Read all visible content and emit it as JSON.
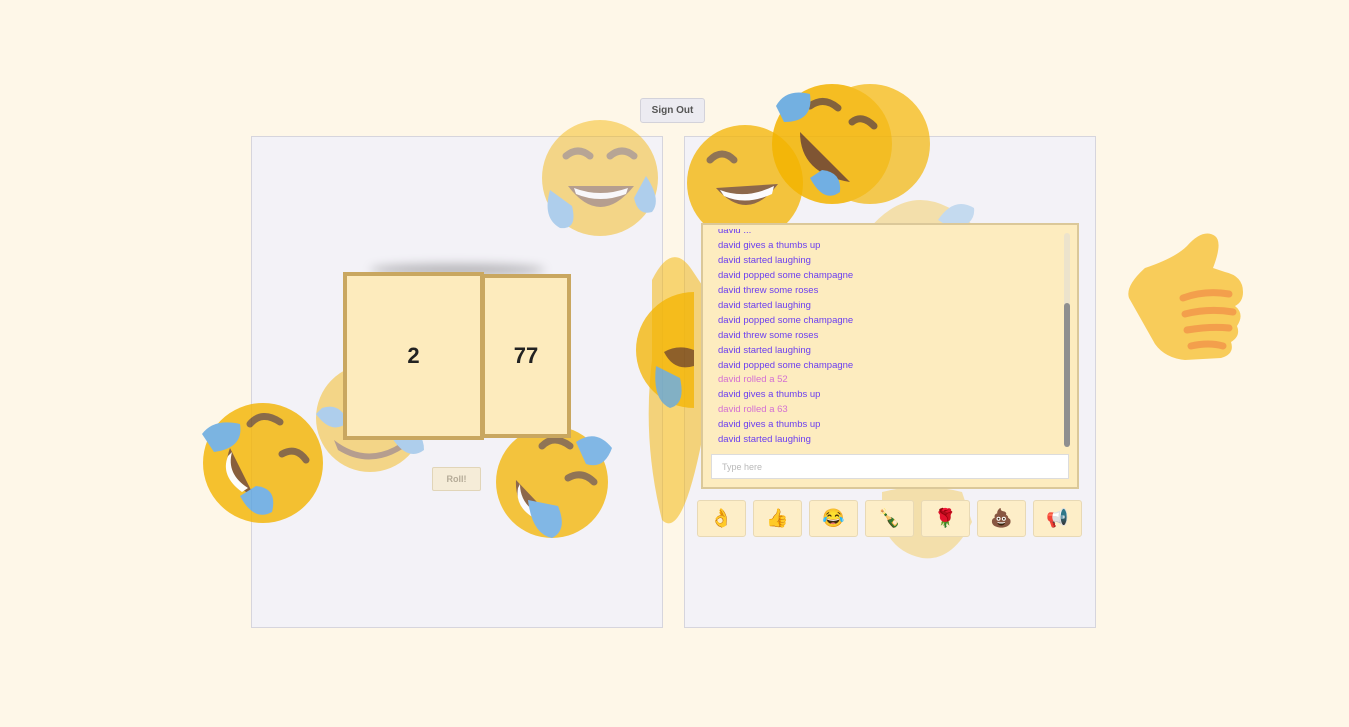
{
  "header": {
    "sign_out_label": "Sign Out"
  },
  "dice": {
    "die_1": "2",
    "die_2": "77",
    "roll_label": "Roll!"
  },
  "chat": {
    "partial_top": "david ...",
    "messages": [
      {
        "text": "david gives a thumbs up",
        "type": "reaction"
      },
      {
        "text": "david started laughing",
        "type": "reaction"
      },
      {
        "text": "david popped some champagne",
        "type": "reaction"
      },
      {
        "text": "david threw some roses",
        "type": "reaction"
      },
      {
        "text": "david started laughing",
        "type": "reaction"
      },
      {
        "text": "david popped some champagne",
        "type": "reaction"
      },
      {
        "text": "david threw some roses",
        "type": "reaction"
      },
      {
        "text": "david started laughing",
        "type": "reaction"
      },
      {
        "text": "david popped some champagne",
        "type": "reaction"
      },
      {
        "text": "david rolled a 52",
        "type": "roll"
      },
      {
        "text": "david gives a thumbs up",
        "type": "reaction"
      },
      {
        "text": "david rolled a 63",
        "type": "roll"
      },
      {
        "text": "david gives a thumbs up",
        "type": "reaction"
      },
      {
        "text": "david started laughing",
        "type": "reaction"
      }
    ],
    "input_placeholder": "Type here",
    "colors": {
      "reaction": "#6b3ef0",
      "roll": "#d36fd3"
    }
  },
  "reactions": [
    {
      "name": "ok-hand",
      "glyph": "👌"
    },
    {
      "name": "thumbs-up",
      "glyph": "👍"
    },
    {
      "name": "laughing",
      "glyph": "😂"
    },
    {
      "name": "champagne",
      "glyph": "🍾"
    },
    {
      "name": "rose",
      "glyph": "🌹"
    },
    {
      "name": "poop",
      "glyph": "💩"
    },
    {
      "name": "megaphone",
      "glyph": "📢"
    }
  ],
  "floating_emojis": [
    "laughing",
    "thumbs-up"
  ],
  "theme": {
    "background": "#fef7e8",
    "die_fill": "#fdebbd",
    "die_border": "#c9a760"
  }
}
